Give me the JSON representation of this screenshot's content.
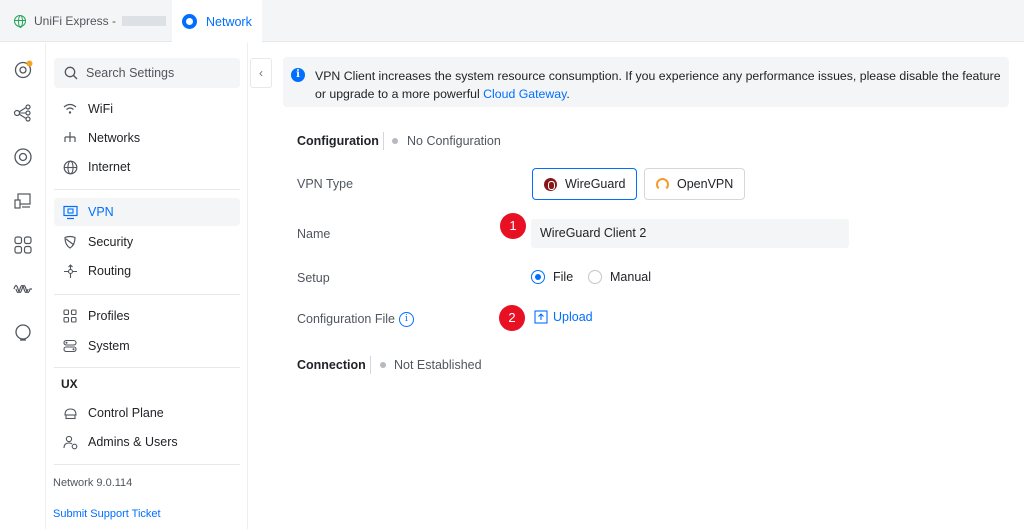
{
  "tabs": [
    {
      "label": "UniFi Express -",
      "icon": "globe-icon"
    },
    {
      "label": "Network",
      "icon": "network-icon"
    }
  ],
  "rail": [
    "dashboard-icon",
    "topology-icon",
    "devices-icon",
    "clients-icon",
    "apps-icon",
    "insights-icon",
    "notifications-icon"
  ],
  "sidebar": {
    "search_placeholder": "Search Settings",
    "group1": [
      {
        "label": "WiFi",
        "icon": "wifi-icon"
      },
      {
        "label": "Networks",
        "icon": "networks-icon"
      },
      {
        "label": "Internet",
        "icon": "internet-icon"
      }
    ],
    "group2": [
      {
        "label": "VPN",
        "icon": "vpn-icon",
        "active": true
      },
      {
        "label": "Security",
        "icon": "shield-icon"
      },
      {
        "label": "Routing",
        "icon": "routing-icon"
      }
    ],
    "group3": [
      {
        "label": "Profiles",
        "icon": "profiles-icon"
      },
      {
        "label": "System",
        "icon": "system-icon"
      }
    ],
    "ux_label": "UX",
    "group4": [
      {
        "label": "Control Plane",
        "icon": "control-plane-icon"
      },
      {
        "label": "Admins & Users",
        "icon": "admins-icon"
      }
    ],
    "version": "Network 9.0.114",
    "support": "Submit Support Ticket"
  },
  "banner": {
    "text": "VPN Client increases the system resource consumption. If you experience any performance issues, please disable the feature or upgrade to a more powerful ",
    "link": "Cloud Gateway",
    "end": "."
  },
  "configuration": {
    "title": "Configuration",
    "status": "No Configuration"
  },
  "form": {
    "vpn_type_label": "VPN Type",
    "vpn_types": [
      "WireGuard",
      "OpenVPN"
    ],
    "selected_vpn_type": "WireGuard",
    "name_label": "Name",
    "name_value": "WireGuard Client 2",
    "setup_label": "Setup",
    "setup_options": [
      "File",
      "Manual"
    ],
    "setup_selected": "File",
    "config_file_label": "Configuration File",
    "upload_label": "Upload"
  },
  "connection": {
    "title": "Connection",
    "status": "Not Established"
  },
  "badges": [
    "1",
    "2"
  ],
  "colors": {
    "accent": "#006fff",
    "badge": "#e81123",
    "wireguard": "#88171a",
    "openvpn": "#f39c2b"
  }
}
